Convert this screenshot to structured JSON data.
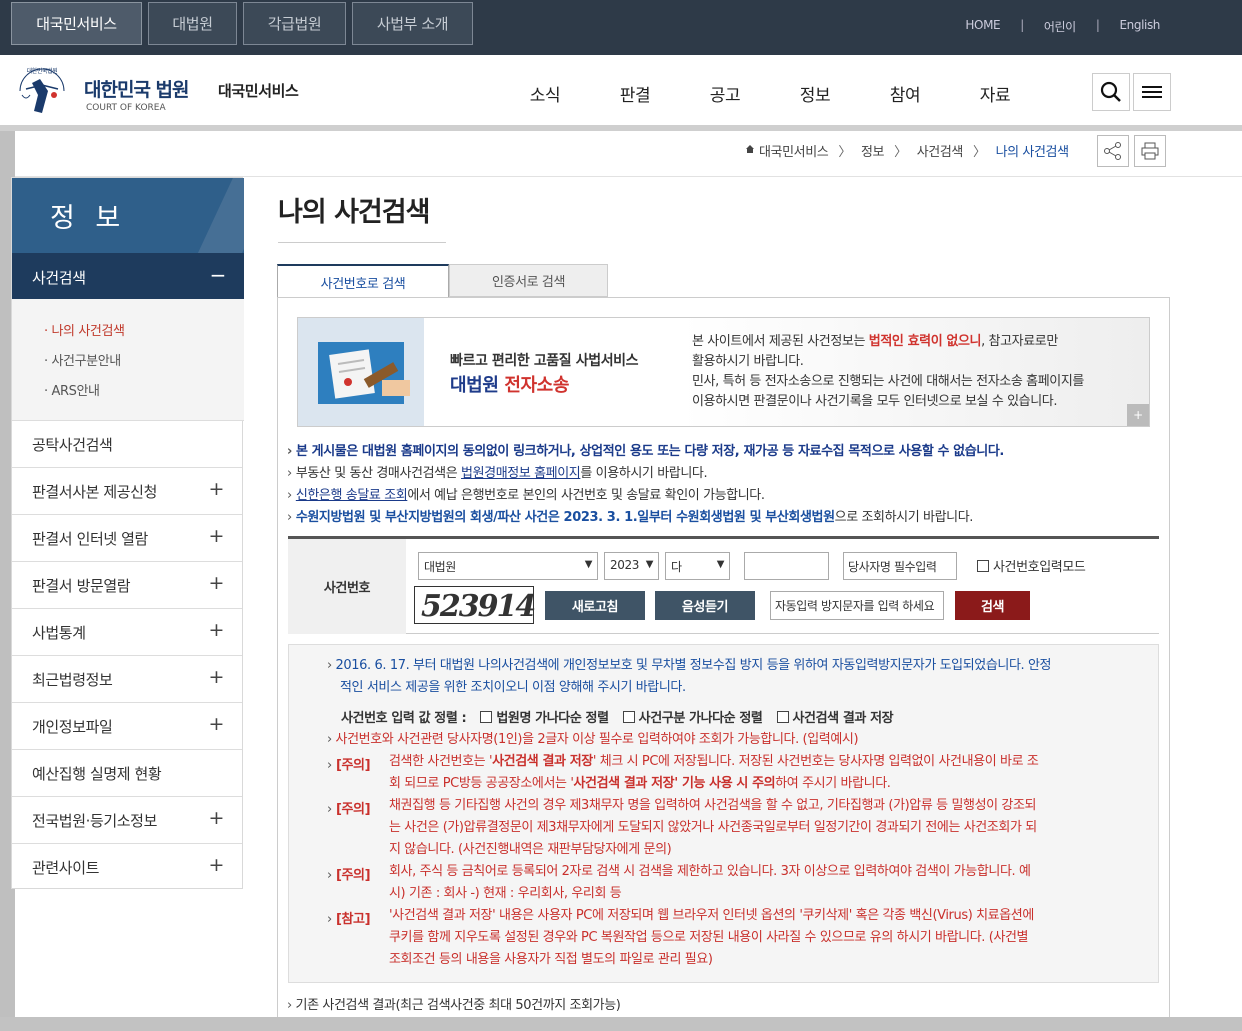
{
  "top": {
    "tabs": [
      "대국민서비스",
      "대법원",
      "각급법원",
      "사법부 소개"
    ],
    "links": [
      "HOME",
      "어린이",
      "English"
    ],
    "sep": "|"
  },
  "header": {
    "brand": "대한민국 법원",
    "brand_sub": "COURT OF KOREA",
    "service": "대국민서비스",
    "logo_text": "대한민국법원",
    "menu": [
      "소식",
      "판결",
      "공고",
      "정보",
      "참여",
      "자료"
    ]
  },
  "breadcrumb": {
    "items": [
      "대국민서비스",
      "정보",
      "사건검색",
      "나의 사건검색"
    ],
    "sep": "〉"
  },
  "lnb": {
    "title": "정 보",
    "active": "사건검색",
    "active_toggle": "−",
    "subs": [
      "나의 사건검색",
      "사건구분안내",
      "ARS안내"
    ],
    "sub_bullet": "·",
    "items": [
      {
        "label": "공탁사건검색",
        "pm": ""
      },
      {
        "label": "판결서사본 제공신청",
        "pm": "+"
      },
      {
        "label": "판결서 인터넷 열람",
        "pm": "+"
      },
      {
        "label": "판결서 방문열람",
        "pm": "+"
      },
      {
        "label": "사법통계",
        "pm": "+"
      },
      {
        "label": "최근법령정보",
        "pm": "+"
      },
      {
        "label": "개인정보파일",
        "pm": "+"
      },
      {
        "label": "예산집행 실명제 현황",
        "pm": ""
      },
      {
        "label": "전국법원·등기소정보",
        "pm": "+"
      },
      {
        "label": "관련사이트",
        "pm": "+"
      }
    ]
  },
  "page": {
    "title": "나의 사건검색",
    "tabs": [
      "사건번호로 검색",
      "인증서로 검색"
    ]
  },
  "banner": {
    "line1": "빠르고 편리한 고품질 사법서비스",
    "line2a": "대법원 ",
    "line2b": "전자소송",
    "n1a": "본 사이트에서 제공된 사건정보는 ",
    "n1b": "법적인 효력이 없으니",
    "n1c": ", 참고자료로만",
    "n2": "활용하시기 바랍니다.",
    "n3": "민사, 특허 등 전자소송으로 진행되는 사건에 대해서는 전자소송 홈페이지를",
    "n4": "이용하시면 판결문이나 사건기록을 모두 인터넷으로 보실 수 있습니다.",
    "plus": "+"
  },
  "notes": {
    "arrow": "›",
    "n1": "본 게시물은 대법원 홈페이지의 동의없이 링크하거나, 상업적인 용도 또는 다량 저장, 재가공 등 자료수집 목적으로 사용할 수 없습니다.",
    "n2a": "부동산 및 동산 경매사건검색은 ",
    "n2b": "법원경매정보 홈페이지",
    "n2c": "를 이용하시기 바랍니다.",
    "n3a": "신한은행 송달료 조회",
    "n3b": "에서 예납 은행번호로 본인의 사건번호 및 송달료 확인이 가능합니다.",
    "n4a": "수원지방법원 및 부산지방법원의 회생/파산 사건은 2023. 3. 1.일부터 수원회생법원 및 부산회생법원",
    "n4b": "으로 조회하시기 바랍니다."
  },
  "search": {
    "label": "사건번호",
    "court": "대법원",
    "year": "2023",
    "type": "다",
    "dropdown_arrow": "▼",
    "number": "",
    "party_placeholder": "당사자명 필수입력",
    "mode_label": "사건번호입력모드",
    "captcha": "523914",
    "refresh": "새로고침",
    "listen": "음성듣기",
    "captcha_placeholder": "자동입력 방지문자를 입력 하세요",
    "submit": "검색"
  },
  "info": {
    "arrow": "›",
    "l1": "2016. 6. 17. 부터 대법원 나의사건검색에 개인정보보호 및 무차별 정보수집 방지 등을 위하여 자동입력방지문자가 도입되었습니다. 안정",
    "l2": "적인 서비스 제공을 위한 조치이오니 이점 양해해 주시기 바랍니다.",
    "sort_label": "사건번호 입력 값 정렬 :",
    "sort1": "법원명 가나다순 정렬",
    "sort2": "사건구분 가나다순 정렬",
    "sort3": "사건검색 결과 저장",
    "l3": "사건번호와 사건관련 당사자명(1인)을 2글자 이상 필수로 입력하여야 조회가 가능합니다. (입력예시)",
    "tag1": "[주의]",
    "c1a": "검색한 사건번호는 '",
    "c1b": "사건검색 결과 저장",
    "c1c": "' 체크 시 PC에 저장됩니다. 저장된 사건번호는 당사자명 입력없이 사건내용이 바로 조",
    "c1d": "회 되므로 PC방등 공공장소에서는 '",
    "c1e": "사건검색 결과 저장' 기능 사용 시 주의",
    "c1f": "하여 주시기 바랍니다.",
    "tag2": "[주의]",
    "c2a": "채권집행 등 기타집행 사건의 경우 제3채무자 명을 입력하여 사건검색을 할 수 없고, 기타집행과 (가)압류 등 밀행성이 강조되",
    "c2b": "는 사건은 (가)압류결정문이 제3채무자에게 도달되지 않았거나 사건종국일로부터 일정기간이 경과되기 전에는 사건조회가 되",
    "c2c": "지 않습니다. (사건진행내역은 재판부담당자에게 문의)",
    "tag3": "[주의]",
    "c3a": "회사, 주식 등 금칙어로 등록되어 2자로 검색 시 검색을 제한하고 있습니다. 3자 이상으로 입력하여야 검색이 가능합니다. 예",
    "c3b": "시) 기존 : 회사 -) 현재 : 우리회사, 우리회 등",
    "tag4": "[참고]",
    "c4a": "'사건검색 결과 저장' 내용은 사용자 PC에 저장되며 웹 브라우저 인터넷 옵션의 '쿠키삭제' 혹은 각종 백신(Virus) 치료옵션에",
    "c4b": "쿠키를 함께 지우도록 설정된 경우와 PC 복원작업 등으로 저장된 내용이 사라질 수 있으므로 유의 하시기 바랍니다. (사건별",
    "c4c": "조회조건 등의 내용을 사용자가 직접 별도의 파일로 관리 필요)"
  },
  "bottom": {
    "text": "기존 사건검색 결과(최근 검색사건중 최대 50건까지 조회가능)"
  },
  "icons": {
    "search": "search-icon",
    "menu": "hamburger-icon",
    "share": "share-icon",
    "print": "print-icon",
    "home": "home-icon",
    "logo": "court-logo"
  },
  "colors": {
    "nav_dark": "#2e3a48",
    "lnb_blue": "#2f5f8a",
    "lnb_active": "#1e3b5d",
    "btn_gray": "#3f5466",
    "btn_red": "#8b1a1a",
    "link_blue": "#1a4fa0",
    "warn_red": "#c9302c"
  }
}
